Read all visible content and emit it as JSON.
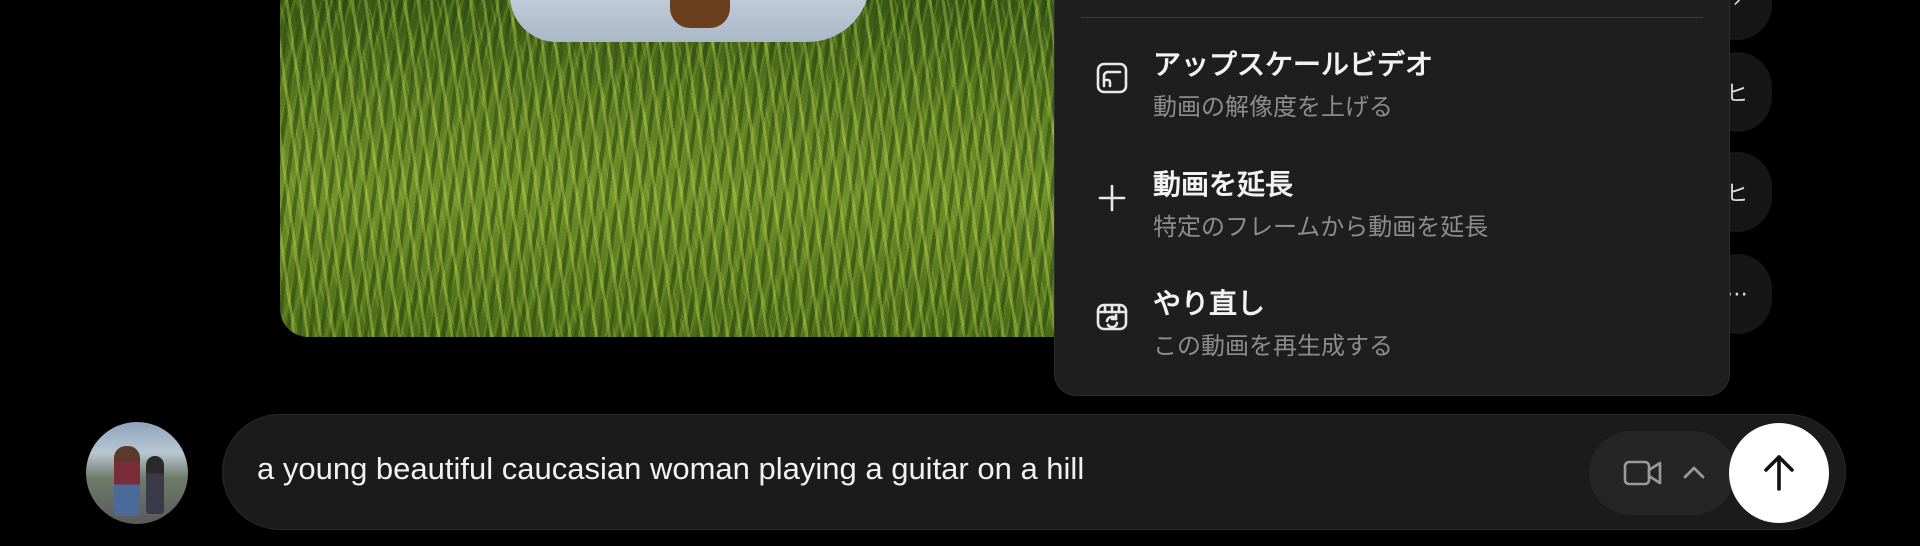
{
  "menu": {
    "items": [
      {
        "title": "アップスケールビデオ",
        "subtitle": "動画の解像度を上げる",
        "icon": "upscale-icon"
      },
      {
        "title": "動画を延長",
        "subtitle": "特定のフレームから動画を延長",
        "icon": "plus-icon"
      },
      {
        "title": "やり直し",
        "subtitle": "この動画を再生成する",
        "icon": "regenerate-icon"
      }
    ]
  },
  "prompt": {
    "text": "a young beautiful caucasian woman playing a guitar on a hill"
  },
  "side_buttons": [
    "ヒ",
    "ヒ",
    "⋯"
  ],
  "colors": {
    "background": "#000000",
    "menu_bg": "#1e1e1e",
    "prompt_bg": "#1b1b1b",
    "send_button": "#ffffff",
    "subtitle_text": "#8c8c8c"
  }
}
